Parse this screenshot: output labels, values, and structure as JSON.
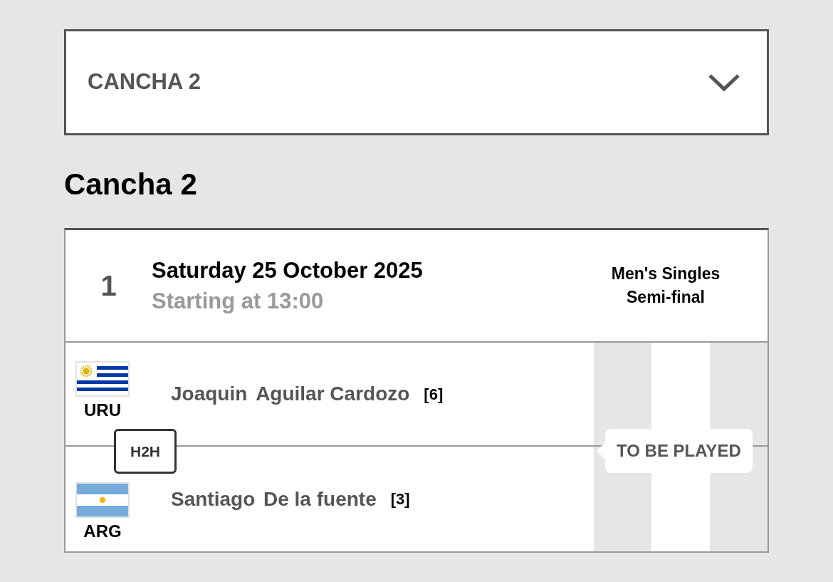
{
  "court_select": {
    "value": "CANCHA 2"
  },
  "heading": "Cancha 2",
  "match": {
    "order": "1",
    "date": "Saturday 25 October 2025",
    "start_time": "Starting at 13:00",
    "event": "Men's Singles",
    "round": "Semi-final",
    "players": [
      {
        "kind": "uruguay",
        "country": "URU",
        "first_name": "Joaquin",
        "last_name": "Aguilar Cardozo",
        "seed": "[6]"
      },
      {
        "kind": "argentina",
        "country": "ARG",
        "first_name": "Santiago",
        "last_name": "De la fuente",
        "seed": "[3]"
      }
    ],
    "h2h_label": "H2H",
    "status": "TO BE PLAYED"
  }
}
